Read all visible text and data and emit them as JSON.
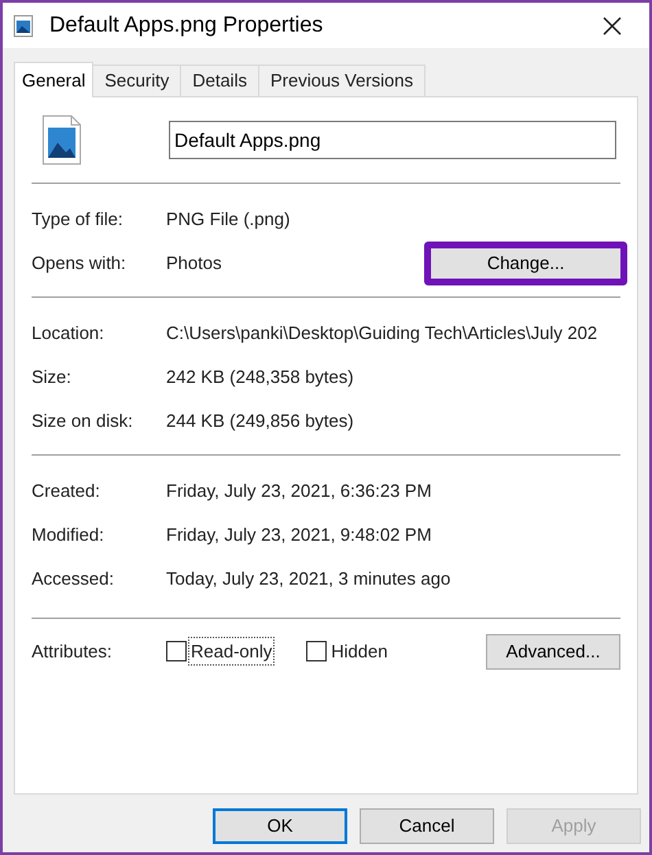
{
  "window": {
    "title": "Default Apps.png Properties"
  },
  "tabs": [
    {
      "label": "General",
      "selected": true
    },
    {
      "label": "Security",
      "selected": false
    },
    {
      "label": "Details",
      "selected": false
    },
    {
      "label": "Previous Versions",
      "selected": false
    }
  ],
  "file_name": {
    "value": "Default Apps.png"
  },
  "sections": [
    {
      "rows": [
        {
          "label": "Type of file:",
          "value": "PNG File (.png)"
        },
        {
          "label": "Opens with:",
          "value": "Photos",
          "button": {
            "label": "Change...",
            "highlighted": true
          }
        }
      ]
    },
    {
      "rows": [
        {
          "label": "Location:",
          "value": "C:\\Users\\panki\\Desktop\\Guiding Tech\\Articles\\July 202"
        },
        {
          "label": "Size:",
          "value": "242 KB (248,358 bytes)"
        },
        {
          "label": "Size on disk:",
          "value": "244 KB (249,856 bytes)"
        }
      ]
    },
    {
      "rows": [
        {
          "label": "Created:",
          "value": "Friday, July 23, 2021, 6:36:23 PM"
        },
        {
          "label": "Modified:",
          "value": "Friday, July 23, 2021, 9:48:02 PM"
        },
        {
          "label": "Accessed:",
          "value": "Today, July 23, 2021, 3 minutes ago"
        }
      ]
    }
  ],
  "attributes": {
    "label": "Attributes:",
    "checkboxes": [
      {
        "label": "Read-only",
        "checked": false,
        "focused": true
      },
      {
        "label": "Hidden",
        "checked": false,
        "focused": false
      }
    ],
    "button": "Advanced..."
  },
  "buttons": [
    {
      "label": "OK",
      "default": true,
      "disabled": false
    },
    {
      "label": "Cancel",
      "default": false,
      "disabled": false
    },
    {
      "label": "Apply",
      "default": false,
      "disabled": true
    }
  ]
}
